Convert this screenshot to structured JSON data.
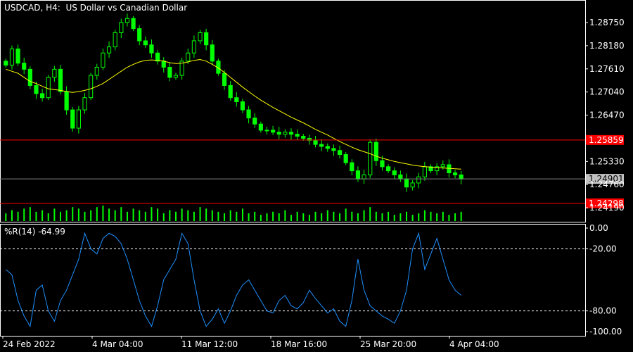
{
  "header": {
    "symbol": "USDCAD",
    "timeframe": "H4:",
    "description": "US Dollar vs Canadian Dollar"
  },
  "indicator": {
    "label": "%R(14) -64.99"
  },
  "colors": {
    "background": "#000000",
    "frame": "#ffffff",
    "bull_candle": "#00ff00",
    "bear_candle": "#ffffff",
    "moving_average": "#ffff00",
    "level_line": "#ff0000",
    "level_badge": "#ff0000",
    "price_line": "#808080",
    "price_badge": "#c0c0c0",
    "volume": "#00ff00",
    "williams_r": "#1e90ff",
    "ind_levels": "#ffffff"
  },
  "chart_data": [
    {
      "type": "candlestick",
      "title": "USDCAD, H4:  US Dollar vs Canadian Dollar",
      "y_ticks": [
        "1.28750",
        "1.28180",
        "1.27610",
        "1.27040",
        "1.26470",
        "1.25330",
        "1.24760",
        "1.24190"
      ],
      "ylim": [
        1.2388,
        1.2927
      ],
      "x_ticks": [
        "24 Feb 2022",
        "4 Mar 04:00",
        "11 Mar 12:00",
        "18 Mar 16:00",
        "25 Mar 20:00",
        "4 Apr 04:00"
      ],
      "close_trace": [
        1.277,
        1.281,
        1.2775,
        1.276,
        1.272,
        1.27,
        1.269,
        1.274,
        1.276,
        1.2705,
        1.266,
        1.2615,
        1.266,
        1.269,
        1.2745,
        1.2765,
        1.28,
        1.2815,
        1.285,
        1.2875,
        1.2885,
        1.286,
        1.283,
        1.282,
        1.28,
        1.278,
        1.2765,
        1.274,
        1.2745,
        1.278,
        1.28,
        1.283,
        1.285,
        1.282,
        1.278,
        1.275,
        1.272,
        1.269,
        1.268,
        1.266,
        1.264,
        1.2625,
        1.261,
        1.261,
        1.2605,
        1.26,
        1.2605,
        1.26,
        1.2595,
        1.259,
        1.2585,
        1.2575,
        1.257,
        1.2565,
        1.256,
        1.255,
        1.253,
        1.251,
        1.249,
        1.25,
        1.258,
        1.2535,
        1.252,
        1.251,
        1.25,
        1.249,
        1.247,
        1.248,
        1.2495,
        1.252,
        1.251,
        1.252,
        1.2525,
        1.2505,
        1.25,
        1.249
      ],
      "ma_trace": [
        1.276,
        1.2755,
        1.275,
        1.274,
        1.273,
        1.2725,
        1.2718,
        1.2712,
        1.271,
        1.2708,
        1.2705,
        1.2703,
        1.2705,
        1.2708,
        1.2712,
        1.2718,
        1.2725,
        1.2735,
        1.2745,
        1.2755,
        1.2765,
        1.2772,
        1.2778,
        1.2782,
        1.2783,
        1.2782,
        1.278,
        1.2776,
        1.2774,
        1.2775,
        1.2778,
        1.2782,
        1.2784,
        1.278,
        1.2772,
        1.2763,
        1.2752,
        1.274,
        1.2728,
        1.2716,
        1.2705,
        1.2694,
        1.2684,
        1.2675,
        1.2666,
        1.2658,
        1.265,
        1.2642,
        1.2635,
        1.2628,
        1.262,
        1.2612,
        1.2605,
        1.2598,
        1.259,
        1.2582,
        1.2575,
        1.2568,
        1.2562,
        1.2557,
        1.2552,
        1.2546,
        1.2541,
        1.2537,
        1.2533,
        1.253,
        1.2527,
        1.2524,
        1.2522,
        1.252,
        1.2519,
        1.2518,
        1.2517,
        1.2516,
        1.2515,
        1.2514
      ],
      "levels": [
        {
          "value": 1.25859,
          "label": "1.25859"
        },
        {
          "value": 1.24298,
          "label": "1.24298"
        }
      ],
      "current_price": {
        "value": 1.24901,
        "label": "1.24901"
      },
      "volume_trace": [
        0.5,
        0.7,
        0.6,
        0.8,
        0.9,
        0.6,
        0.7,
        0.5,
        0.8,
        0.6,
        0.7,
        0.9,
        0.8,
        0.6,
        0.7,
        0.9,
        1.0,
        0.8,
        0.7,
        0.9,
        0.6,
        0.8,
        0.7,
        0.6,
        0.9,
        0.8,
        0.5,
        0.7,
        0.6,
        0.8,
        0.7,
        0.6,
        0.9,
        0.8,
        0.7,
        0.6,
        0.5,
        0.7,
        0.6,
        0.8,
        0.5,
        0.6,
        0.4,
        0.5,
        0.6,
        0.5,
        0.7,
        0.4,
        0.6,
        0.5,
        0.4,
        0.6,
        0.5,
        0.7,
        0.6,
        0.5,
        0.8,
        0.6,
        0.5,
        0.7,
        0.9,
        0.6,
        0.5,
        0.6,
        0.4,
        0.5,
        0.6,
        0.4,
        0.5,
        0.7,
        0.6,
        0.5,
        0.6,
        0.4,
        0.5,
        0.6
      ]
    },
    {
      "type": "line",
      "title": "%R(14) -64.99",
      "ylim": [
        -100,
        0
      ],
      "y_ticks": [
        "0.00",
        "-20.00",
        "-80.00",
        "-100.00"
      ],
      "levels": [
        -20,
        -80
      ],
      "values": [
        -40,
        -45,
        -70,
        -85,
        -95,
        -60,
        -55,
        -80,
        -90,
        -70,
        -60,
        -45,
        -30,
        -5,
        -20,
        -25,
        -10,
        -5,
        -8,
        -15,
        -30,
        -50,
        -70,
        -85,
        -95,
        -75,
        -50,
        -40,
        -30,
        -5,
        -15,
        -50,
        -80,
        -95,
        -88,
        -78,
        -92,
        -80,
        -65,
        -55,
        -50,
        -60,
        -70,
        -80,
        -82,
        -70,
        -65,
        -75,
        -78,
        -72,
        -60,
        -68,
        -75,
        -82,
        -78,
        -90,
        -95,
        -70,
        -30,
        -60,
        -75,
        -80,
        -85,
        -88,
        -92,
        -80,
        -60,
        -20,
        -5,
        -40,
        -25,
        -10,
        -30,
        -50,
        -60,
        -64.99
      ]
    }
  ]
}
